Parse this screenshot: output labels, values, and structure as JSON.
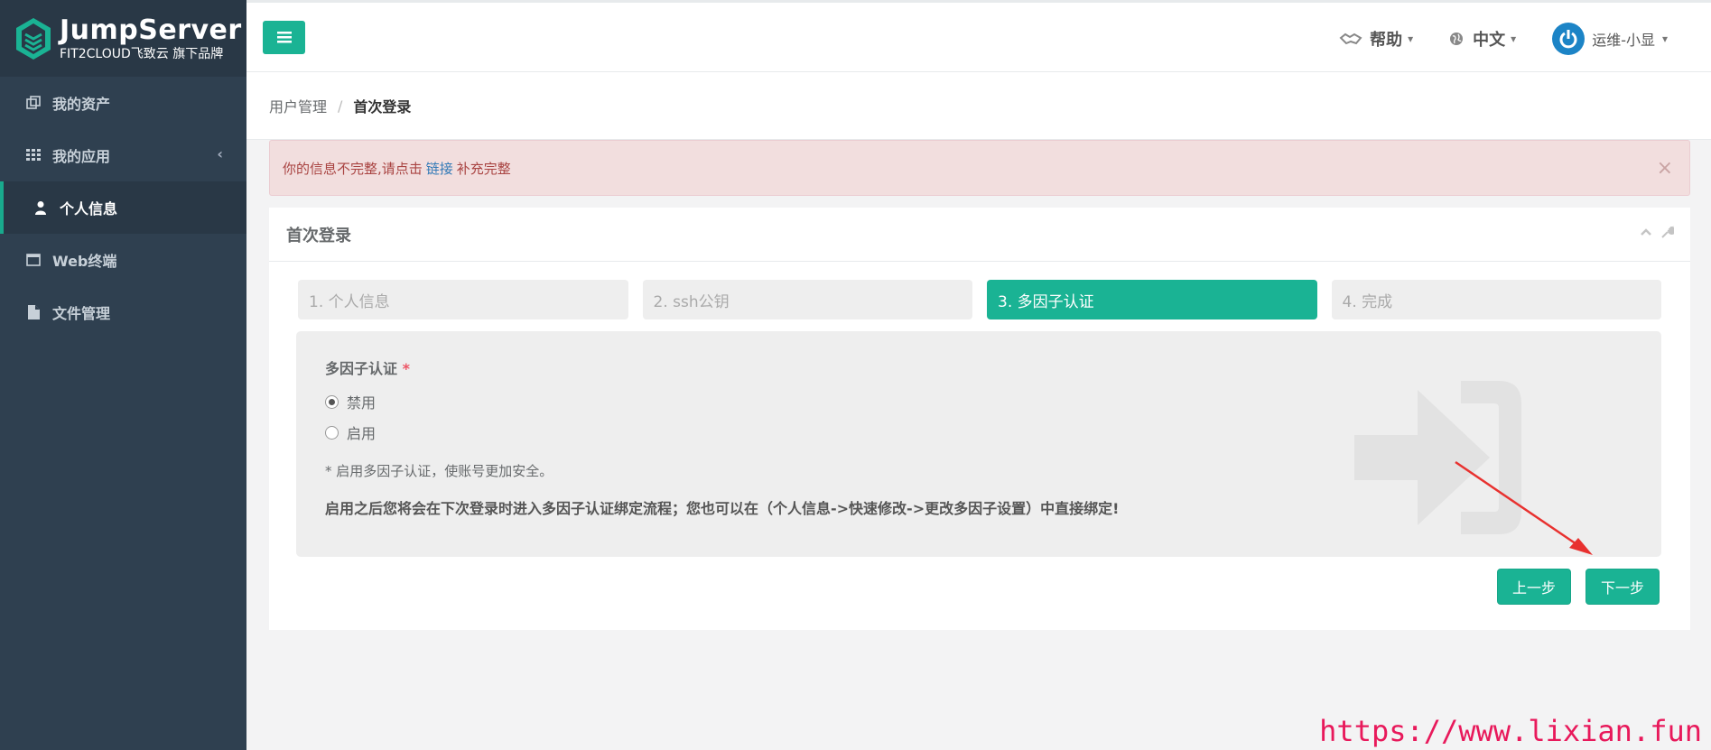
{
  "brand": {
    "name": "JumpServer",
    "tagline": "FIT2CLOUD飞致云 旗下品牌"
  },
  "sidebar": {
    "items": [
      {
        "label": "我的资产",
        "icon": "assets-icon"
      },
      {
        "label": "我的应用",
        "icon": "grid-icon",
        "has_caret": true
      },
      {
        "label": "个人信息",
        "icon": "user-icon",
        "active": true
      },
      {
        "label": "Web终端",
        "icon": "window-icon"
      },
      {
        "label": "文件管理",
        "icon": "file-icon"
      }
    ]
  },
  "topbar": {
    "help_label": "帮助",
    "language_label": "中文",
    "user_label": "运维-小显"
  },
  "breadcrumb": {
    "parent": "用户管理",
    "separator": "/",
    "current": "首次登录"
  },
  "alert": {
    "text_before": "你的信息不完整,请点击",
    "link_text": "链接",
    "text_after": "补充完整",
    "close": "×"
  },
  "panel": {
    "title": "首次登录",
    "steps": [
      {
        "label": "1. 个人信息"
      },
      {
        "label": "2. ssh公钥"
      },
      {
        "label": "3. 多因子认证",
        "current": true
      },
      {
        "label": "4. 完成"
      }
    ],
    "field_label": "多因子认证",
    "required_mark": "*",
    "options": [
      {
        "label": "禁用",
        "selected": true
      },
      {
        "label": "启用",
        "selected": false
      }
    ],
    "hint": "* 启用多因子认证，使账号更加安全。",
    "notice": "启用之后您将会在下次登录时进入多因子认证绑定流程；您也可以在（个人信息->快速修改->更改多因子设置）中直接绑定!",
    "prev_button": "上一步",
    "next_button": "下一步"
  },
  "watermark_url": "https://www.lixian.fun",
  "colors": {
    "sidebar_bg": "#2f4050",
    "accent": "#1ab394",
    "alert_bg": "#f2dede",
    "alert_text": "#a94442",
    "watermark": "#e8195b"
  }
}
